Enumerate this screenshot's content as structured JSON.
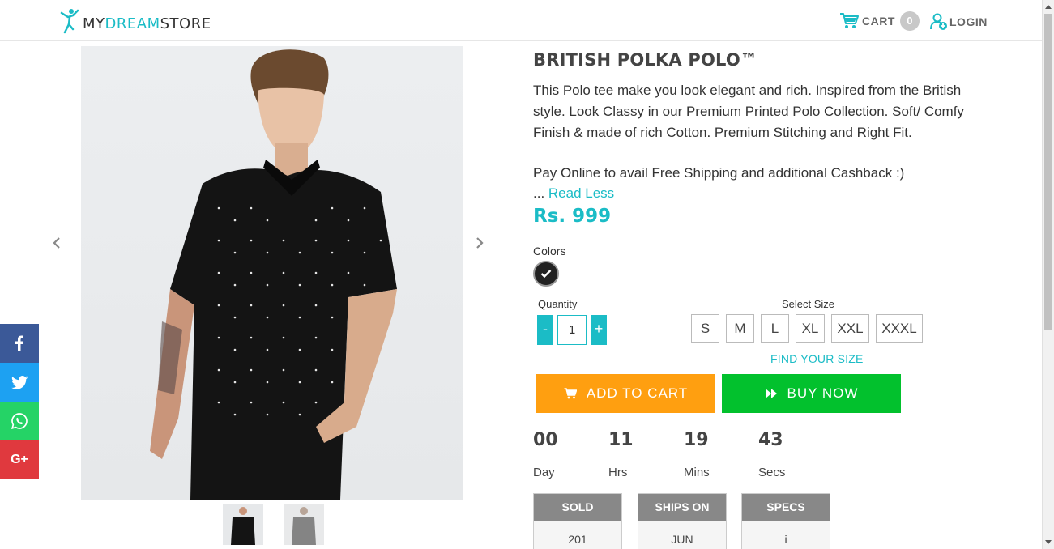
{
  "header": {
    "logo": {
      "my": "MY",
      "dream": "DREAM",
      "store": "STORE"
    },
    "cart_label": "CART",
    "cart_count": "0",
    "login_label": "LOGIN"
  },
  "product": {
    "title": "BRITISH POLKA POLO™",
    "description": "This Polo tee make you look elegant and rich. Inspired from the British style.  Look Classy in our Premium Printed Polo Collection. Soft/ Comfy Finish & made of rich Cotton. Premium Stitching and Right Fit.",
    "pay_note": "Pay Online to avail Free Shipping and additional Cashback :)",
    "ellipsis": "... ",
    "read_less": "Read Less",
    "price": "Rs. 999",
    "colors_label": "Colors",
    "colors": [
      {
        "hex": "#222222",
        "selected": true
      }
    ],
    "quantity_label": "Quantity",
    "quantity_minus": "-",
    "quantity_plus": "+",
    "quantity_value": "1",
    "size_label": "Select Size",
    "sizes": [
      "S",
      "M",
      "L",
      "XL",
      "XXL",
      "XXXL"
    ],
    "find_size": "FIND YOUR SIZE",
    "add_to_cart": "ADD TO CART",
    "buy_now": "BUY NOW"
  },
  "countdown": [
    {
      "value": "00",
      "unit": "Day"
    },
    {
      "value": "11",
      "unit": "Hrs"
    },
    {
      "value": "19",
      "unit": "Mins"
    },
    {
      "value": "43",
      "unit": "Secs"
    }
  ],
  "info_boxes": [
    {
      "title": "SOLD",
      "value": "201"
    },
    {
      "title": "SHIPS ON",
      "value": "JUN"
    },
    {
      "title": "SPECS",
      "value": "i"
    }
  ],
  "social": [
    "facebook-icon",
    "twitter-icon",
    "whatsapp-icon",
    "google-plus-icon"
  ],
  "social_gplus_text": "G+",
  "colors": {
    "accent": "#1bbcc6",
    "add_to_cart": "#ff9f10",
    "buy_now": "#02c12d"
  }
}
